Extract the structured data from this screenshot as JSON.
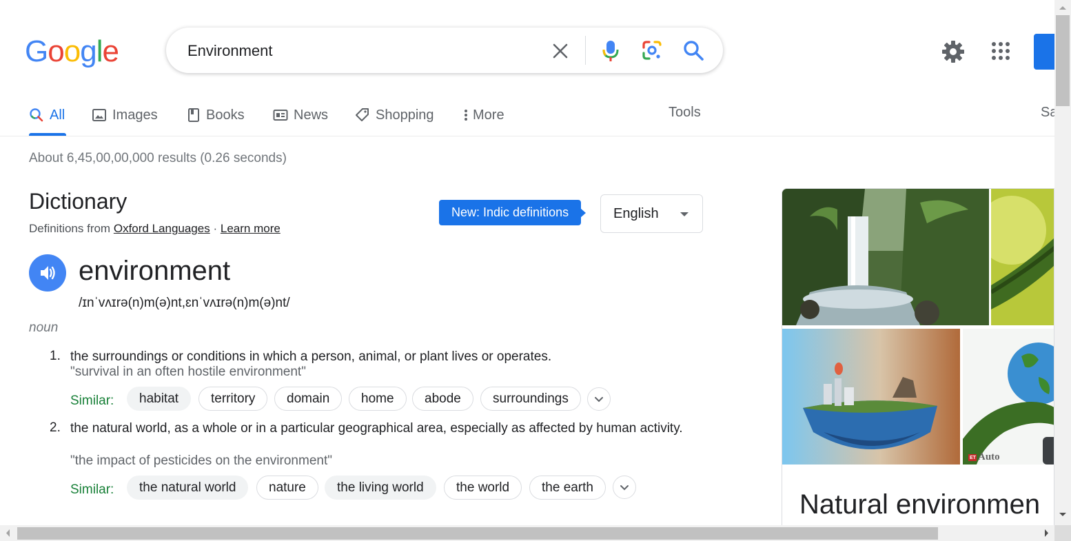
{
  "logo": {
    "text": "Google",
    "letters": [
      {
        "ch": "G",
        "color": "#4285f4"
      },
      {
        "ch": "o",
        "color": "#ea4335"
      },
      {
        "ch": "o",
        "color": "#fbbc05"
      },
      {
        "ch": "g",
        "color": "#4285f4"
      },
      {
        "ch": "l",
        "color": "#34a853"
      },
      {
        "ch": "e",
        "color": "#ea4335"
      }
    ]
  },
  "search": {
    "value": "Environment",
    "icons": [
      "close-icon",
      "mic-icon",
      "lens-icon",
      "search-icon"
    ]
  },
  "header_icons": [
    "settings-icon",
    "apps-icon"
  ],
  "tabs": [
    {
      "label": "All",
      "icon": "search-icon",
      "active": true
    },
    {
      "label": "Images",
      "icon": "image-icon"
    },
    {
      "label": "Books",
      "icon": "book-icon"
    },
    {
      "label": "News",
      "icon": "news-icon"
    },
    {
      "label": "Shopping",
      "icon": "tag-icon"
    },
    {
      "label": "More",
      "icon": "more-vert-icon"
    }
  ],
  "tools_label": "Tools",
  "safesearch_label": "Sa",
  "result_stats": "About 6,45,00,00,000 results (0.26 seconds)",
  "dictionary": {
    "title": "Dictionary",
    "source_prefix": "Definitions from",
    "source_link": "Oxford Languages",
    "separator": "·",
    "learn_more": "Learn more",
    "new_badge": "New: Indic definitions",
    "language": "English",
    "word": "environment",
    "phonetic": "/ɪnˈvʌɪrə(n)m(ə)nt,ɛnˈvʌɪrə(n)m(ə)nt/",
    "part_of_speech": "noun",
    "similar_label": "Similar:",
    "definitions": [
      {
        "num": "1.",
        "text": "the surroundings or conditions in which a person, animal, or plant lives or operates.",
        "example": "\"survival in an often hostile environment\"",
        "similar": [
          "habitat",
          "territory",
          "domain",
          "home",
          "abode",
          "surroundings"
        ]
      },
      {
        "num": "2.",
        "text": "the natural world, as a whole or in a particular geographical area, especially as affected by human activity.",
        "example": "\"the impact of pesticides on the environment\"",
        "similar": [
          "the natural world",
          "nature",
          "the living world",
          "the world",
          "the earth"
        ]
      }
    ]
  },
  "knowledge_panel": {
    "title": "Natural environmen",
    "image_watermark": "Auto",
    "image_watermark_badge": "ET"
  },
  "colors": {
    "accent": "#1a73e8",
    "similar_green": "#188038",
    "muted": "#70757a"
  }
}
